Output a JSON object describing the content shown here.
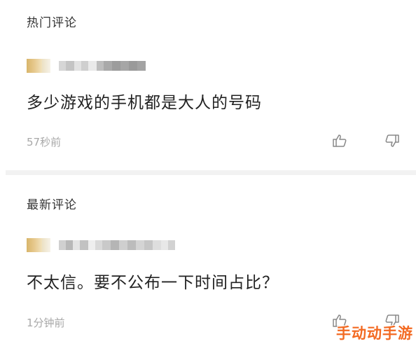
{
  "hot_section": {
    "title": "热门评论",
    "comment": {
      "text": "多少游戏的手机都是大人的号码",
      "time": "57秒前"
    }
  },
  "new_section": {
    "title": "最新评论",
    "comment": {
      "text": "不太信。要不公布一下时间占比？",
      "time": "1分钟前"
    }
  },
  "icons": {
    "like": "thumbs-up-icon",
    "dislike": "thumbs-down-icon"
  },
  "watermark": "手动动手游",
  "colors": {
    "watermark": "#f36a22",
    "timestamp": "#a8a8a8",
    "divider": "#f2f2f2"
  }
}
